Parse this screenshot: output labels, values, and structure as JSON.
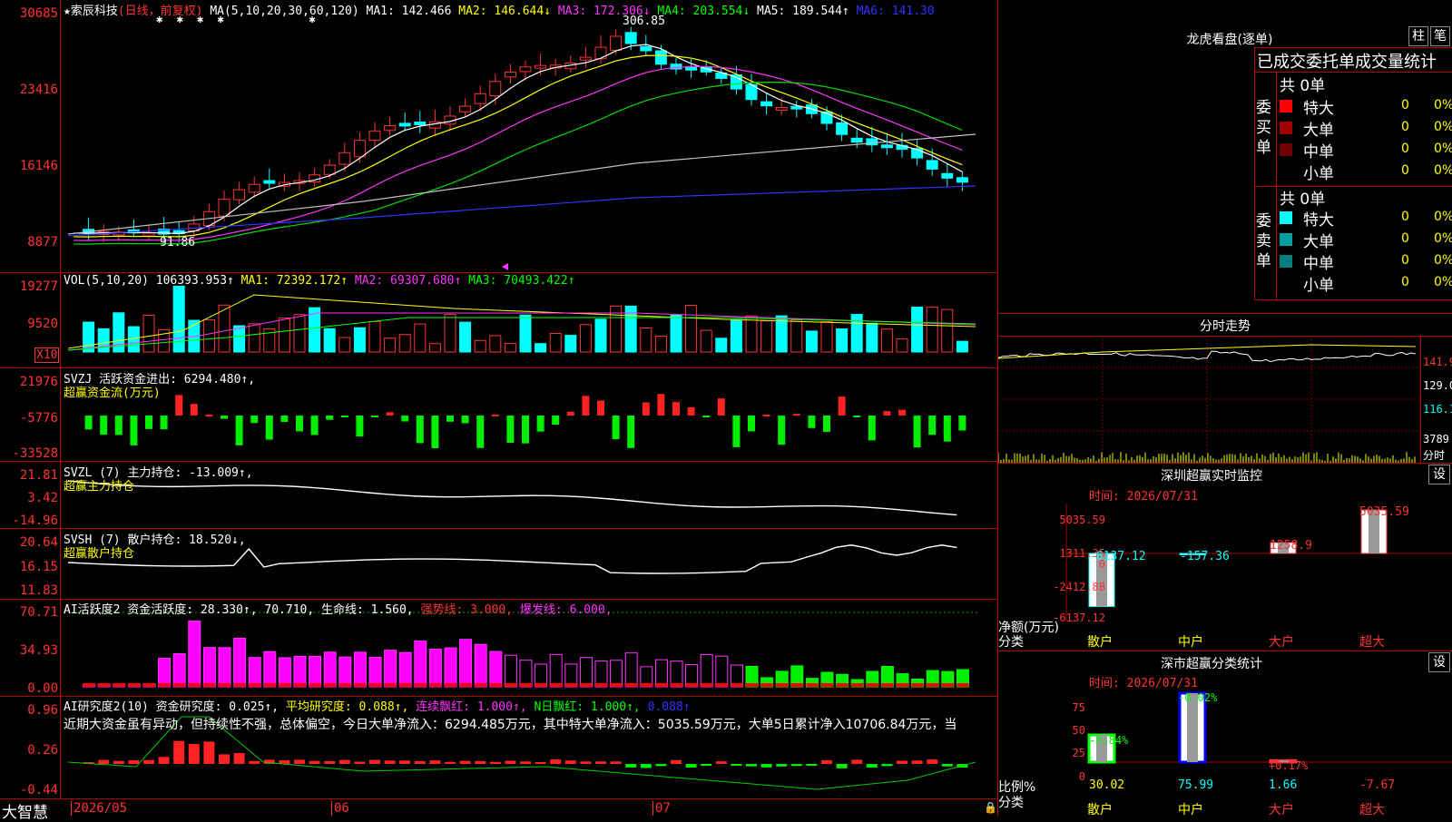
{
  "stock": {
    "name": "★索辰科技",
    "mode": "(日线，前复权)"
  },
  "ma_header": {
    "label": "MA(5,10,20,30,60,120)",
    "ma1": "MA1: 142.466",
    "ma2": "MA2: 146.644↓",
    "ma3": "MA3: 172.306↓",
    "ma4": "MA4: 203.554↓",
    "ma5": "MA5: 189.544↑",
    "ma6": "MA6: 141.30"
  },
  "price_axis": [
    "30685",
    "23416",
    "16146",
    "8877"
  ],
  "price_marks": {
    "high": "306.85",
    "low": "91.86"
  },
  "vol_header": {
    "label": "VOL(5,10,20)",
    "value": "106393.953↑",
    "ma1": "MA1: 72392.172↑",
    "ma2": "MA2: 69307.680↑",
    "ma3": "MA3: 70493.422↑"
  },
  "vol_axis": [
    "19277",
    "9520"
  ],
  "vol_unit": "X10",
  "svzj": {
    "label": "SVZJ  活跃资金进出: 6294.480↑,",
    "sub": "超赢资金流(万元)",
    "axis": [
      "21976",
      "-5776",
      "-33528"
    ]
  },
  "svzl": {
    "label": "SVZL (7) 主力持仓: -13.009↑,",
    "sub": "超赢主力持仓",
    "axis": [
      "21.81",
      "3.42",
      "-14.96"
    ]
  },
  "svsh": {
    "label": "SVSH (7) 散户持仓: 18.520↓,",
    "sub": "超赢散户持仓",
    "axis": [
      "20.64",
      "16.15",
      "11.83"
    ]
  },
  "ai1": {
    "label": "AI活跃度2 资金活跃度: 28.330↑, 70.710, 生命线: 1.560,",
    "strong": "强势线: 3.000,",
    "burst": "爆发线: 6.000,",
    "axis": [
      "70.71",
      "34.93",
      "0.00"
    ]
  },
  "ai2": {
    "label": "AI研究度2(10) 资金研究度: 0.025↑,",
    "avg": "平均研究度: 0.088↑,",
    "cont": "连续飘红: 1.000↑,",
    "nday": "N日飘红: 1.000↑,",
    "tail": "0.088↑",
    "axis": [
      "0.96",
      "0.26",
      "-0.44"
    ]
  },
  "commentary": "近期大资金虽有异动，但持续性不强，总体偏空，今日大单净流入：6294.485万元，其中特大单净流入：5035.59万元，大单5日累计净入10706.84万元，当",
  "date_axis": {
    "brand": "大智慧",
    "d1": "2026/05",
    "d2": "06",
    "d3": "07"
  },
  "lhb": {
    "title": "龙虎看盘(逐单)",
    "btn1": "柱",
    "btn2": "笔",
    "subtitle": "已成交委托单成交量统计",
    "buy": {
      "side": "委买单",
      "total": "共 0单",
      "rows": [
        {
          "name": "特大",
          "v": "0",
          "p": "0%",
          "color": "#ff0000"
        },
        {
          "name": "大单",
          "v": "0",
          "p": "0%",
          "color": "#a00000"
        },
        {
          "name": "中单",
          "v": "0",
          "p": "0%",
          "color": "#700000"
        },
        {
          "name": "小单",
          "v": "0",
          "p": "0%",
          "color": "#000000"
        }
      ]
    },
    "sell": {
      "side": "委卖单",
      "total": "共 0单",
      "rows": [
        {
          "name": "特大",
          "v": "0",
          "p": "0%",
          "color": "#00ffff"
        },
        {
          "name": "大单",
          "v": "0",
          "p": "0%",
          "color": "#00a0a0"
        },
        {
          "name": "中单",
          "v": "0",
          "p": "0%",
          "color": "#008080"
        },
        {
          "name": "小单",
          "v": "0",
          "p": "0%",
          "color": "#000000"
        }
      ]
    }
  },
  "fenshi": {
    "title": "分时走势",
    "axis": [
      "141.9",
      "129.0",
      "116.1",
      "3789"
    ],
    "unit": "分时"
  },
  "monitor": {
    "title": "深圳超赢实时监控",
    "btn": "设",
    "time": "时间: 2026/07/31",
    "axis": [
      "5035.59",
      "1311.35",
      "0",
      "-2412.88",
      "-6137.12"
    ],
    "ylab": "净额(万元)",
    "xlab": "分类",
    "cats": [
      "散户",
      "中户",
      "大户",
      "超大"
    ],
    "values": [
      -6137.12,
      -157.36,
      1258.9,
      5035.59
    ],
    "labels": [
      "-6137.12",
      "-157.36",
      "1258.9",
      "5035.59"
    ]
  },
  "classify": {
    "title": "深市超赢分类统计",
    "btn": "设",
    "time": "时间: 2026/07/31",
    "axis": [
      "75",
      "50",
      "25",
      "0"
    ],
    "ylab": "比例%",
    "xlab": "分类",
    "cats": [
      "散户",
      "中户",
      "大户",
      "超大"
    ],
    "values": [
      30.02,
      75.99,
      1.66,
      -7.67
    ],
    "labels": [
      "30.02",
      "75.99",
      "1.66",
      "-7.67"
    ],
    "changes": [
      "-0.84%",
      "-0.02%",
      "+0.17%",
      ""
    ]
  }
}
